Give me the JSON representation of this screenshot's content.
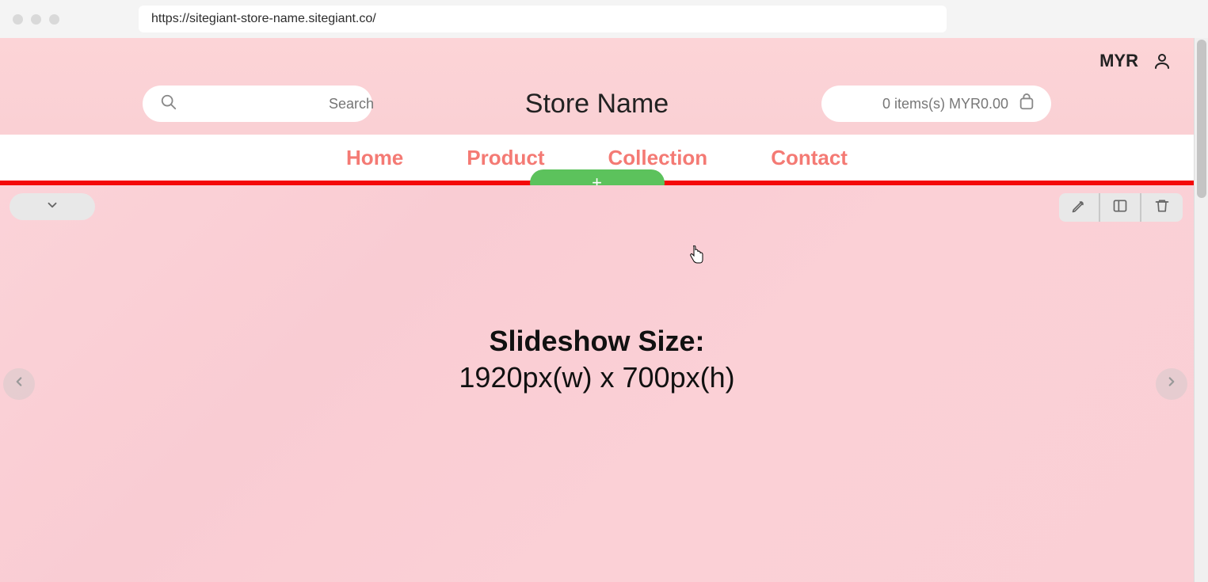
{
  "browser": {
    "url": "https://sitegiant-store-name.sitegiant.co/"
  },
  "header": {
    "currency": "MYR",
    "search_placeholder": "Search",
    "store_title": "Store Name",
    "cart_label": "0 items(s) MYR0.00"
  },
  "nav": {
    "items": [
      "Home",
      "Product",
      "Collection",
      "Contact"
    ]
  },
  "add_section_label": "+",
  "slideshow": {
    "title": "Slideshow Size:",
    "dimensions": "1920px(w) x 700px(h)"
  }
}
